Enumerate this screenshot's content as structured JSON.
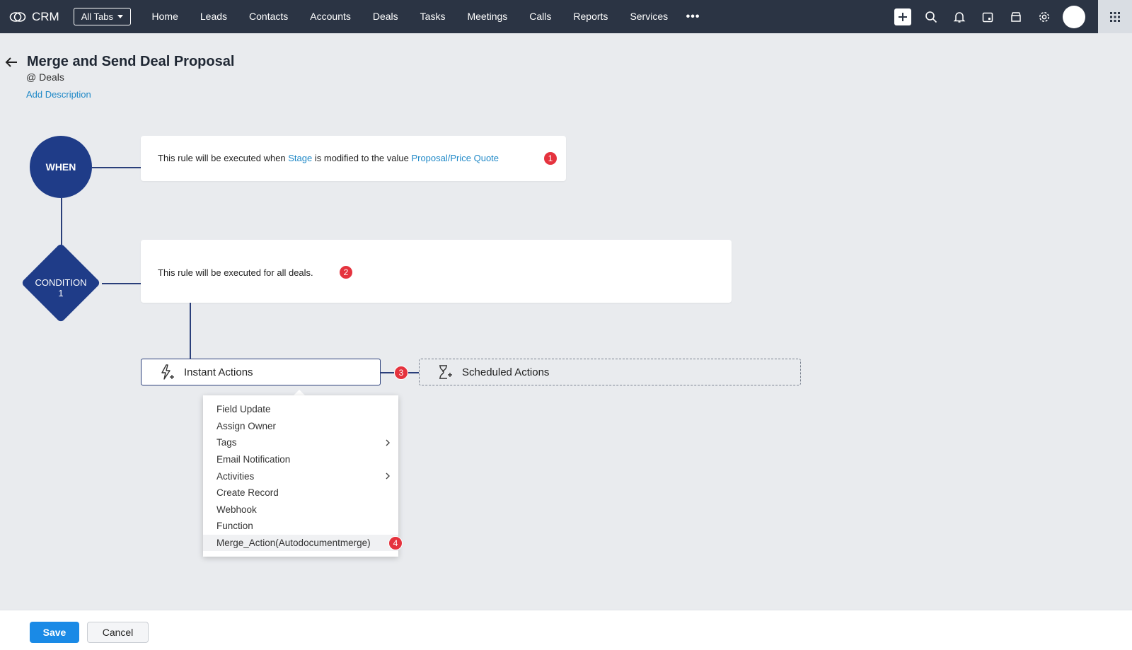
{
  "app": {
    "name": "CRM"
  },
  "topbar": {
    "all_tabs": "All Tabs",
    "nav": [
      "Home",
      "Leads",
      "Contacts",
      "Accounts",
      "Deals",
      "Tasks",
      "Meetings",
      "Calls",
      "Reports",
      "Services"
    ],
    "more": "•••",
    "icons": [
      "plus-icon",
      "search-icon",
      "bell-icon",
      "calendar-icon",
      "store-icon",
      "gear-icon",
      "avatar",
      "apps-grid-icon"
    ]
  },
  "header": {
    "title": "Merge and Send Deal Proposal",
    "module_prefix": "@",
    "module": "Deals",
    "add_description": "Add Description"
  },
  "flow": {
    "when_label": "WHEN",
    "condition_label_line1": "CONDITION",
    "condition_label_line2": "1",
    "when_text_1": "This rule will be executed when ",
    "when_field": "Stage",
    "when_text_2": " is modified to the value ",
    "when_value": "Proposal/Price Quote",
    "condition_text": "This rule will be executed for all deals.",
    "instant_actions": "Instant Actions",
    "scheduled_actions": "Scheduled Actions",
    "badges": [
      "1",
      "2",
      "3",
      "4"
    ]
  },
  "menu": {
    "items": [
      {
        "label": "Field Update",
        "submenu": false
      },
      {
        "label": "Assign Owner",
        "submenu": false
      },
      {
        "label": "Tags",
        "submenu": true
      },
      {
        "label": "Email Notification",
        "submenu": false
      },
      {
        "label": "Activities",
        "submenu": true
      },
      {
        "label": "Create Record",
        "submenu": false
      },
      {
        "label": "Webhook",
        "submenu": false
      },
      {
        "label": "Function",
        "submenu": false
      },
      {
        "label": "Merge_Action(Autodocumentmerge)",
        "submenu": false
      }
    ],
    "highlighted": "Merge_Action(Autodocumentmerge)"
  },
  "footer": {
    "save": "Save",
    "cancel": "Cancel"
  },
  "colors": {
    "topbar": "#2b3444",
    "node": "#1f3c88",
    "link": "#1e88c7",
    "badge": "#e5333e",
    "save": "#1a8ae6"
  }
}
